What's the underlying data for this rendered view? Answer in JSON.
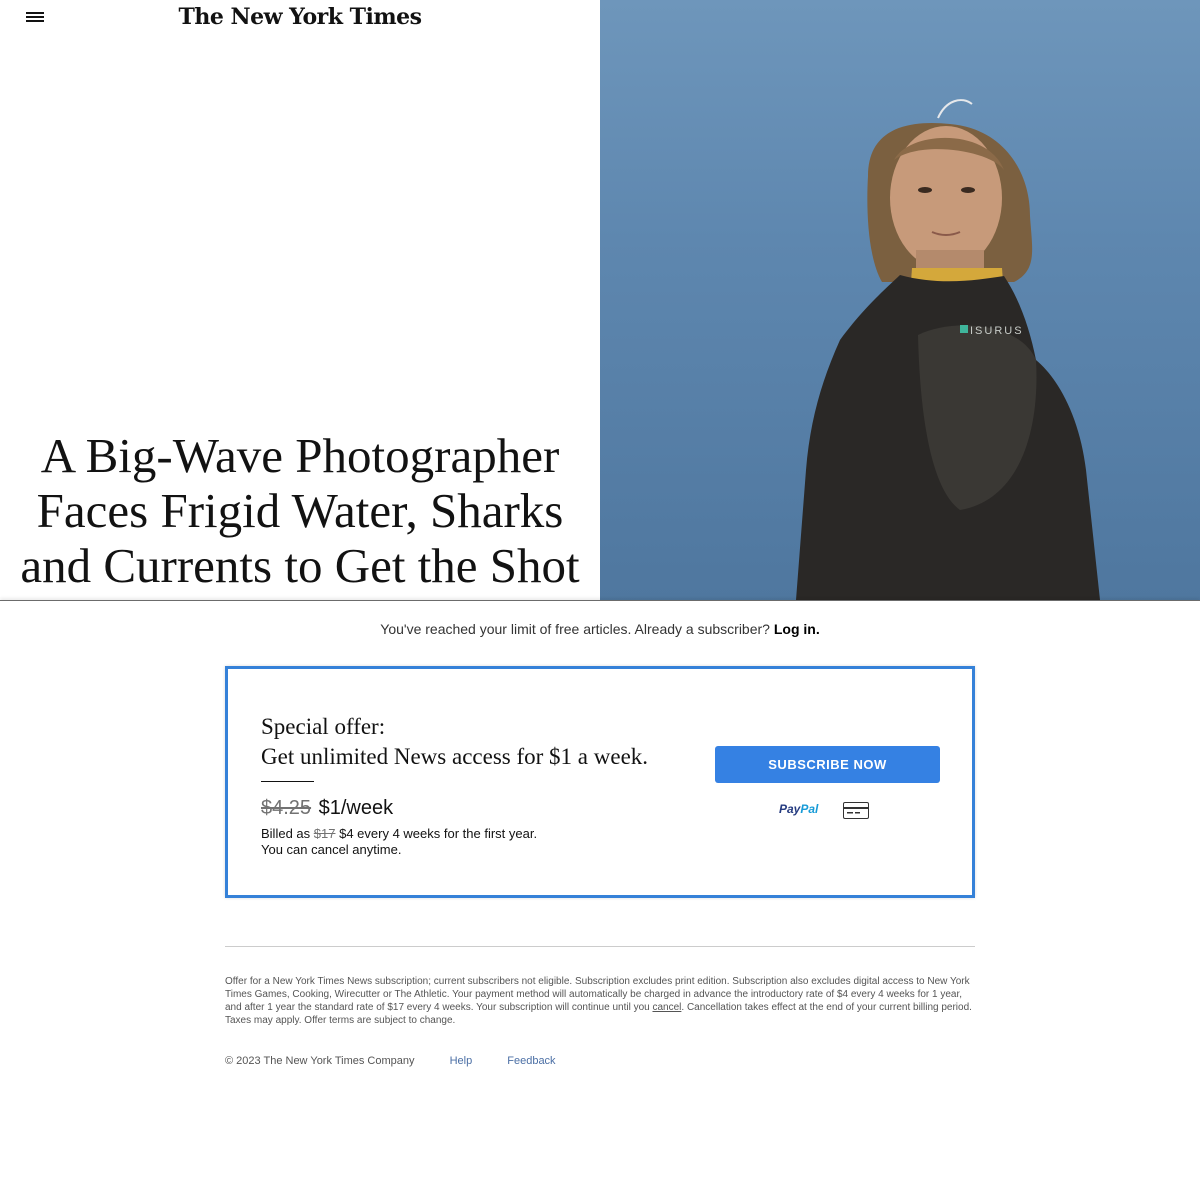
{
  "header": {
    "logo_text": "The New York Times"
  },
  "article": {
    "headline": "A Big-Wave Photographer Faces Frigid Water, Sharks and Currents to Get the Shot",
    "photo_wetsuit_logo": "ISURUS"
  },
  "paywall": {
    "limit_text": "You've reached your limit of free articles. Already a subscriber?",
    "login_label": "Log in.",
    "offer": {
      "title_line1": "Special offer:",
      "title_line2": "Get unlimited News access for $1 a week.",
      "old_price": "$4.25",
      "new_price": "$1/week",
      "billing_prefix": "Billed as",
      "billing_old": "$17",
      "billing_rest": "$4 every 4 weeks for the first year.",
      "cancel_note": "You can cancel anytime.",
      "subscribe_label": "SUBSCRIBE NOW",
      "paypal_pay": "Pay",
      "paypal_pal": "Pal"
    },
    "terms_before_link": "Offer for a New York Times News subscription; current subscribers not eligible. Subscription excludes print edition. Subscription also excludes digital access to New York Times Games, Cooking, Wirecutter or The Athletic. Your payment method will automatically be charged in advance the introductory rate of $4 every 4 weeks for 1 year, and after 1 year the standard rate of $17 every 4 weeks. Your subscription will continue until you",
    "terms_link": "cancel",
    "terms_after_link": ". Cancellation takes effect at the end of your current billing period. Taxes may apply. Offer terms are subject to change.",
    "footer": {
      "copyright": "© 2023 The New York Times Company",
      "help": "Help",
      "feedback": "Feedback"
    }
  },
  "colors": {
    "accent_blue": "#3581e3",
    "box_border": "#3581d8",
    "sky_blue": "#6e96bb"
  },
  "icons": [
    "hamburger-menu-icon",
    "paypal-icon",
    "credit-card-icon"
  ]
}
